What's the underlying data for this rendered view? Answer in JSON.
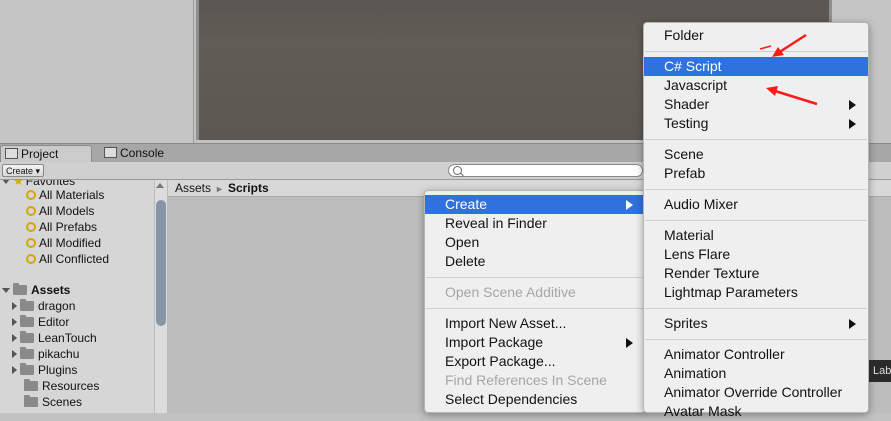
{
  "tabs": {
    "project": "Project",
    "console": "Console"
  },
  "toolbar": {
    "create_label": "Create ▾"
  },
  "tree": {
    "favorites_label": "Favorites",
    "favorites": [
      "All Materials",
      "All Models",
      "All Prefabs",
      "All Modified",
      "All Conflicted"
    ],
    "assets_label": "Assets",
    "folders": [
      "dragon",
      "Editor",
      "LeanTouch",
      "pikachu",
      "Plugins",
      "Resources",
      "Scenes"
    ]
  },
  "breadcrumb": {
    "root": "Assets",
    "sep": "►",
    "current": "Scripts"
  },
  "context_menu": {
    "items": [
      "Create",
      "Reveal in Finder",
      "Open",
      "Delete",
      "Open Scene Additive",
      "Import New Asset...",
      "Import Package",
      "Export Package...",
      "Find References In Scene",
      "Select Dependencies"
    ]
  },
  "create_submenu": {
    "items": [
      "Folder",
      "C# Script",
      "Javascript",
      "Shader",
      "Testing",
      "Scene",
      "Prefab",
      "Audio Mixer",
      "Material",
      "Lens Flare",
      "Render Texture",
      "Lightmap Parameters",
      "Sprites",
      "Animator Controller",
      "Animation",
      "Animator Override Controller",
      "Avatar Mask"
    ]
  },
  "corner_label": "Lab",
  "colors": {
    "highlight": "#2f72dd",
    "annotation_arrow": "#ff1a1a"
  }
}
